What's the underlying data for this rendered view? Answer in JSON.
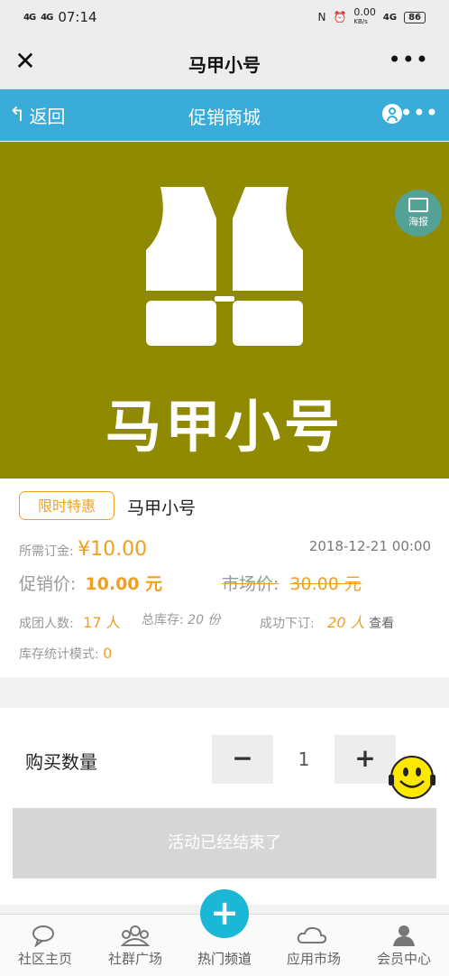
{
  "status": {
    "signal1": "4G",
    "signal2": "4G",
    "time": "07:14",
    "nfc": "N",
    "speed": "0.00",
    "speed_unit": "KB/s",
    "net": "4G",
    "battery": "86"
  },
  "window": {
    "title": "马甲小号"
  },
  "navbar": {
    "back_label": "返回",
    "title": "促销商城"
  },
  "hero": {
    "brand_text": "马甲小号",
    "background_color": "#8f8a00",
    "poster_label": "海报"
  },
  "product": {
    "badge": "限时特惠",
    "name": "马甲小号",
    "deposit_label": "所需订金:",
    "deposit_value": "¥10.00",
    "date": "2018-12-21 00:00",
    "promo_label": "促销价:",
    "promo_value": "10.00 元",
    "market_label": "市场价:",
    "market_value": "30.00 元",
    "group_label": "成团人数:",
    "group_value": "17 人",
    "stock_label": "总库存:",
    "stock_value": "20 份",
    "orders_label": "成功下订:",
    "orders_value": "20 人",
    "view_label": "查看",
    "mode_label": "库存统计模式:",
    "mode_value": "0"
  },
  "purchase": {
    "qty_label": "购买数量",
    "minus": "−",
    "plus": "+",
    "qty_value": "1",
    "ended_label": "活动已经结束了"
  },
  "tabs": [
    {
      "label": "社区主页",
      "icon": "chat-icon"
    },
    {
      "label": "社群广场",
      "icon": "group-icon"
    },
    {
      "label": "热门频道",
      "icon": "plus-icon"
    },
    {
      "label": "应用市场",
      "icon": "cloud-icon"
    },
    {
      "label": "会员中心",
      "icon": "user-icon"
    }
  ],
  "colors": {
    "accent": "#f0a020",
    "nav_blue": "#3aacd9",
    "plus_button": "#1ab8d6"
  }
}
